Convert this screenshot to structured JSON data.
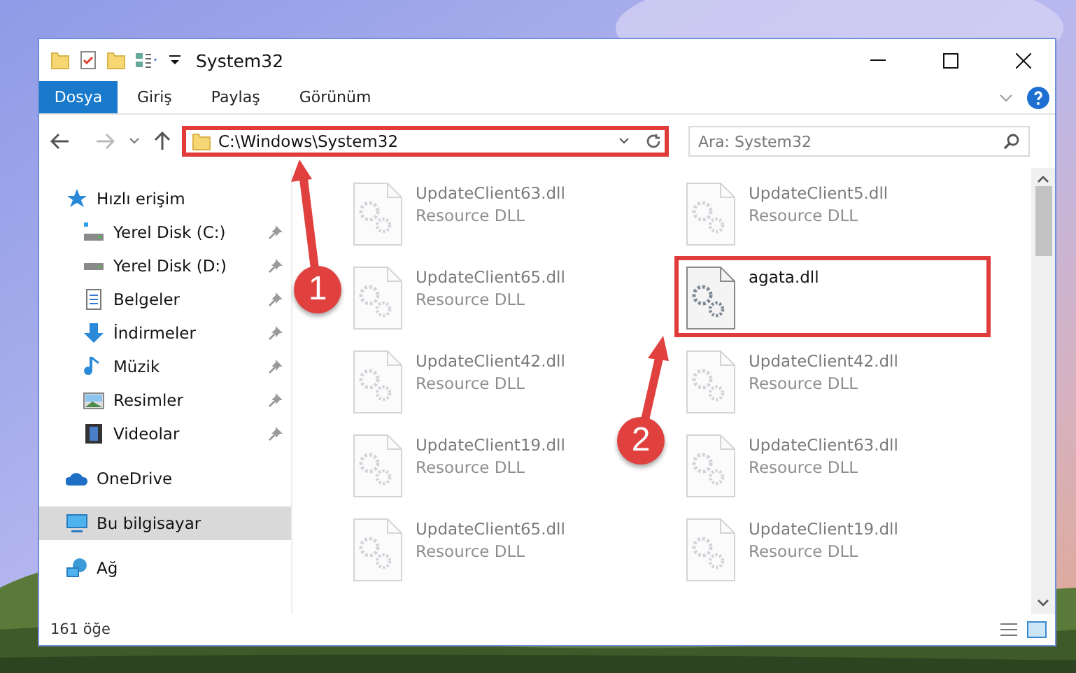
{
  "window": {
    "title": "System32"
  },
  "ribbon": {
    "tabs": [
      {
        "label": "Dosya",
        "selected": true
      },
      {
        "label": "Giriş",
        "selected": false
      },
      {
        "label": "Paylaş",
        "selected": false
      },
      {
        "label": "Görünüm",
        "selected": false
      }
    ]
  },
  "address_bar": {
    "path": "C:\\Windows\\System32",
    "highlighted": true
  },
  "search": {
    "placeholder": "Ara: System32"
  },
  "sidebar": {
    "items": [
      {
        "label": "Hızlı erişim",
        "kind": "star",
        "selected": false,
        "children": [
          {
            "label": "Yerel Disk (C:)",
            "kind": "drive-c",
            "selected": false,
            "pinned": true
          },
          {
            "label": "Yerel Disk (D:)",
            "kind": "drive",
            "selected": false,
            "pinned": true
          },
          {
            "label": "Belgeler",
            "kind": "document",
            "selected": false,
            "pinned": true
          },
          {
            "label": "İndirmeler",
            "kind": "download",
            "selected": false,
            "pinned": true
          },
          {
            "label": "Müzik",
            "kind": "music",
            "selected": false,
            "pinned": true
          },
          {
            "label": "Resimler",
            "kind": "pictures",
            "selected": false,
            "pinned": true
          },
          {
            "label": "Videolar",
            "kind": "video",
            "selected": false,
            "pinned": true
          }
        ]
      },
      {
        "label": "OneDrive",
        "kind": "cloud",
        "selected": false
      },
      {
        "label": "Bu bilgisayar",
        "kind": "computer",
        "selected": true
      },
      {
        "label": "Ağ",
        "kind": "network",
        "selected": false
      }
    ]
  },
  "files": [
    {
      "name": "UpdateClient63.dll",
      "type": "Resource DLL",
      "blurred": true,
      "highlighted": false
    },
    {
      "name": "UpdateClient5.dll",
      "type": "Resource DLL",
      "blurred": true,
      "highlighted": false
    },
    {
      "name": "UpdateClient65.dll",
      "type": "Resource DLL",
      "blurred": true,
      "highlighted": false
    },
    {
      "name": "agata.dll",
      "blurred": false,
      "highlighted": true
    },
    {
      "name": "UpdateClient42.dll",
      "type": "Resource DLL",
      "blurred": true,
      "highlighted": false
    },
    {
      "name": "UpdateClient42.dll",
      "type": "Resource DLL",
      "blurred": true,
      "highlighted": false
    },
    {
      "name": "UpdateClient19.dll",
      "type": "Resource DLL",
      "blurred": true,
      "highlighted": false
    },
    {
      "name": "UpdateClient63.dll",
      "type": "Resource DLL",
      "blurred": true,
      "highlighted": false
    },
    {
      "name": "UpdateClient65.dll",
      "type": "Resource DLL",
      "blurred": true,
      "highlighted": false
    },
    {
      "name": "UpdateClient19.dll",
      "type": "Resource DLL",
      "blurred": true,
      "highlighted": false
    }
  ],
  "status_bar": {
    "count": "161 öğe"
  },
  "annotations": [
    {
      "label": "1"
    },
    {
      "label": "2"
    }
  ]
}
